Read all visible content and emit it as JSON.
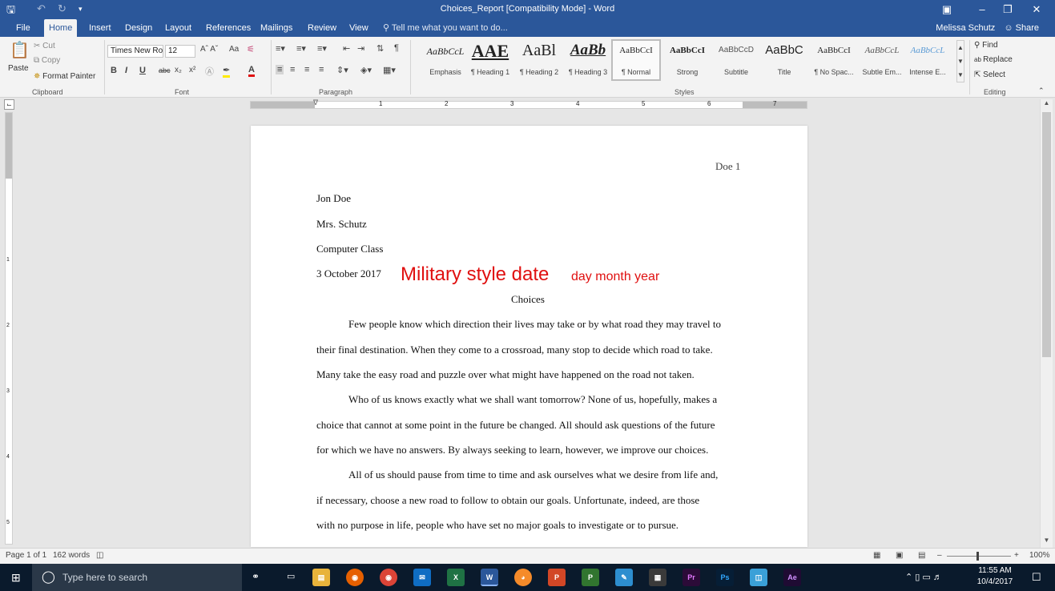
{
  "window": {
    "title": "Choices_Report [Compatibility Mode] - Word",
    "save_icon": "floppy-icon",
    "undo_icon": "undo-icon",
    "redo_icon": "redo-icon",
    "customize_icon": "dropdown-icon"
  },
  "tabs": [
    "File",
    "Home",
    "Insert",
    "Design",
    "Layout",
    "References",
    "Mailings",
    "Review",
    "View"
  ],
  "tellme": "Tell me what you want to do...",
  "user": {
    "name": "Melissa Schutz",
    "share": "Share"
  },
  "clipboard": {
    "label": "Clipboard",
    "paste": "Paste",
    "cut": "Cut",
    "copy": "Copy",
    "format_painter": "Format Painter"
  },
  "font": {
    "label": "Font",
    "name": "Times New Ro",
    "size": "12",
    "bold": "B",
    "italic": "I",
    "underline": "U",
    "strike": "abc",
    "sub": "x₂",
    "sup": "x²",
    "case": "Aa"
  },
  "paragraph": {
    "label": "Paragraph"
  },
  "styles": {
    "label": "Styles",
    "items": [
      {
        "preview": "AaBbCcL",
        "name": "Emphasis"
      },
      {
        "preview": "AAE",
        "name": "¶ Heading 1"
      },
      {
        "preview": "AaBl",
        "name": "¶ Heading 2"
      },
      {
        "preview": "AaBb",
        "name": "¶ Heading 3"
      },
      {
        "preview": "AaBbCcI",
        "name": "¶ Normal"
      },
      {
        "preview": "AaBbCcI",
        "name": "Strong"
      },
      {
        "preview": "AaBbCcD",
        "name": "Subtitle"
      },
      {
        "preview": "AaBbC",
        "name": "Title"
      },
      {
        "preview": "AaBbCcI",
        "name": "¶ No Spac..."
      },
      {
        "preview": "AaBbCcL",
        "name": "Subtle Em..."
      },
      {
        "preview": "AaBbCcL",
        "name": "Intense E..."
      }
    ]
  },
  "editing": {
    "label": "Editing",
    "find": "Find",
    "replace": "Replace",
    "select": "Select"
  },
  "ruler": {
    "numbers": [
      "1",
      "2",
      "3",
      "4",
      "5",
      "6",
      "7"
    ],
    "vnumbers": [
      "1",
      "2",
      "3",
      "4",
      "5"
    ]
  },
  "document": {
    "header": "Doe 1",
    "lines": [
      "Jon Doe",
      "Mrs. Schutz",
      "Computer Class",
      "3 October 2017"
    ],
    "title": "Choices",
    "body": [
      "Few people know which direction their lives may take or by what road they may travel to",
      "their final destination.  When they come to a crossroad, many stop to decide which road to take.",
      "Many take the easy road and puzzle over what might have happened on the road not taken.",
      "Who of us knows exactly what we shall want tomorrow?  None of us, hopefully, makes a",
      "choice that cannot at some point in the future be changed.  All should ask questions of the future",
      "for which we have no answers.  By always seeking to learn, however, we improve our choices.",
      "All of us should pause from time to time and ask ourselves what we desire from life and,",
      "if necessary, choose a new road to follow to obtain our goals.  Unfortunate, indeed, are those",
      "with no purpose in life, people who have set no major goals to investigate or to pursue."
    ],
    "annotation_big": "Military style date",
    "annotation_small": "day month year",
    "annotation_color": "#e01010"
  },
  "status": {
    "page": "Page 1 of 1",
    "words": "162 words",
    "zoom": "100%"
  },
  "taskbar": {
    "search_placeholder": "Type here to search",
    "time": "11:55 AM",
    "date": "10/4/2017",
    "apps": [
      "X",
      "W",
      "P",
      "P",
      "Pr",
      "Ps",
      "Ae"
    ]
  }
}
